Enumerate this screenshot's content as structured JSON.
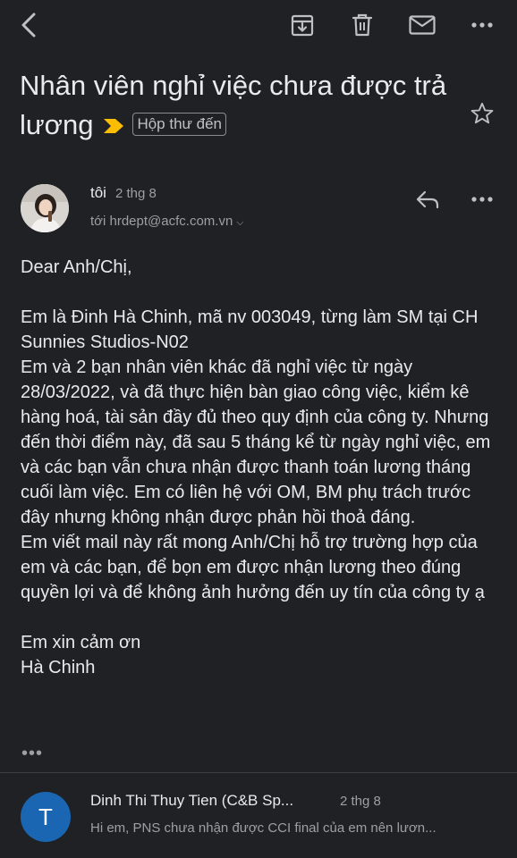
{
  "toolbar": {
    "back_icon": "back-arrow-icon",
    "archive_icon": "archive-icon",
    "delete_icon": "trash-icon",
    "mark_unread_icon": "mail-icon",
    "more_icon": "more-horizontal-icon"
  },
  "subject": {
    "text": "Nhân viên nghỉ việc chưa được trả lương",
    "label": "Hộp thư đến",
    "important_color": "#fbbc04"
  },
  "message": {
    "sender": "tôi",
    "date": "2 thg 8",
    "recipient": "tới hrdept@acfc.com.vn",
    "body": "Dear Anh/Chị,\n\nEm là Đinh Hà Chinh, mã nv 003049, từng làm SM tại CH Sunnies Studios-N02\nEm và 2 bạn nhân viên khác đã nghỉ việc từ ngày 28/03/2022, và đã thực hiện bàn giao công việc, kiểm kê hàng hoá, tài sản đầy đủ theo quy định của công ty. Nhưng đến thời điểm này, đã sau 5 tháng kể từ ngày nghỉ việc, em và các bạn vẫn chưa nhận được thanh toán lương tháng cuối làm việc. Em có liên hệ với OM, BM phụ trách trước đây nhưng không nhận được phản hồi thoả đáng.\nEm viết mail này rất mong Anh/Chị hỗ trợ trường hợp của em và các bạn, để bọn em được nhận lương theo đúng quyền lợi và để không ảnh hưởng đến uy tín của công ty ạ\n\nEm xin cảm ơn\nHà Chinh",
    "trimmed_indicator": "•••"
  },
  "reply": {
    "avatar_letter": "T",
    "avatar_color": "#1a66b3",
    "sender": "Dinh Thi Thuy Tien (C&B Sp...",
    "date": "2 thg 8",
    "snippet": "Hi em, PNS chưa nhận được CCI final của em nên lươn..."
  }
}
